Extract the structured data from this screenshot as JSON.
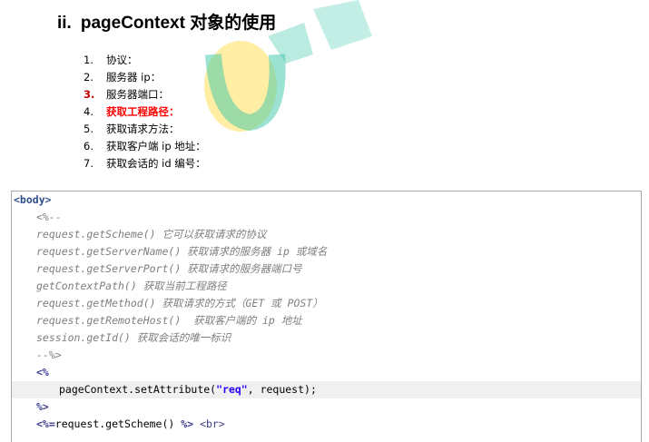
{
  "heading": {
    "number": "ii.",
    "title": "pageContext 对象的使用"
  },
  "list": [
    {
      "n": "1.",
      "text": "协议：",
      "highlight": false
    },
    {
      "n": "2.",
      "text": "服务器 ip：",
      "highlight": false
    },
    {
      "n": "3.",
      "text": "服务器端口：",
      "highlight": false
    },
    {
      "n": "4.",
      "text": "获取工程路径：",
      "highlight": true
    },
    {
      "n": "5.",
      "text": "获取请求方法：",
      "highlight": false
    },
    {
      "n": "6.",
      "text": "获取客户端 ip 地址：",
      "highlight": false
    },
    {
      "n": "7.",
      "text": "获取会话的 id 编号：",
      "highlight": false
    }
  ],
  "code": {
    "body_open": "<body>",
    "comment_open": "<%--",
    "comment_lines": [
      "request.getScheme() 它可以获取请求的协议",
      "request.getServerName() 获取请求的服务器 ip 或域名",
      "request.getServerPort() 获取请求的服务器端口号",
      "getContextPath() 获取当前工程路径",
      "request.getMethod() 获取请求的方式（GET 或 POST）",
      "request.getRemoteHost()  获取客户端的 ip 地址",
      "session.getId() 获取会话的唯一标识"
    ],
    "comment_close": "--%>",
    "scriptlet_open": "<%",
    "scriptlet_code_a": "pageContext.setAttribute(",
    "scriptlet_string": "\"req\"",
    "scriptlet_code_b": ", request);",
    "scriptlet_close": "%>",
    "expr_open": "<%=",
    "expr_body": "request.getScheme() ",
    "expr_close": "%>",
    "br_tag": "<br>"
  },
  "colors": {
    "highlight_red": "#ff0000",
    "watermark_green": "#39c6a8",
    "watermark_yellow": "#ffe05a"
  }
}
